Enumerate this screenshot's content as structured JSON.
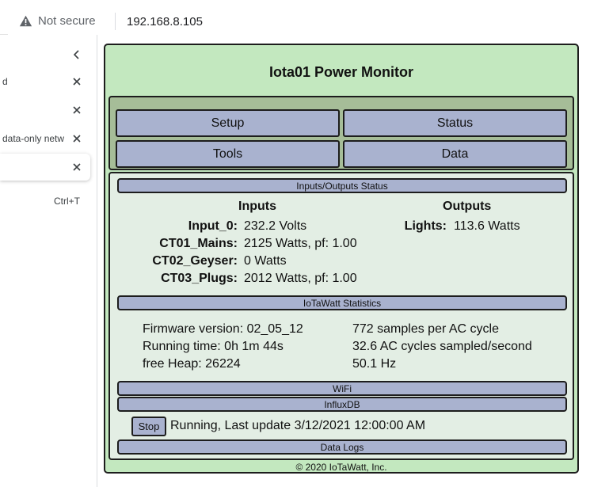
{
  "browser": {
    "security_label": "Not secure",
    "url": "192.168.8.105"
  },
  "sidebar": {
    "tabs": [
      {
        "label": "d"
      },
      {
        "label": ""
      },
      {
        "label": "data-only netw"
      },
      {
        "label": ""
      }
    ],
    "shortcut": "Ctrl+T"
  },
  "app": {
    "title": "Iota01 Power Monitor",
    "nav": {
      "setup": "Setup",
      "status": "Status",
      "tools": "Tools",
      "data": "Data"
    },
    "io_status": {
      "header": "Inputs/Outputs Status",
      "inputs_title": "Inputs",
      "outputs_title": "Outputs",
      "inputs": [
        {
          "name": "Input_0:",
          "value": "232.2 Volts"
        },
        {
          "name": "CT01_Mains:",
          "value": "2125 Watts, pf: 1.00"
        },
        {
          "name": "CT02_Geyser:",
          "value": "0 Watts"
        },
        {
          "name": "CT03_Plugs:",
          "value": "2012 Watts, pf: 1.00"
        }
      ],
      "outputs": [
        {
          "name": "Lights:",
          "value": "113.6 Watts"
        }
      ]
    },
    "statistics": {
      "header": "IoTaWatt Statistics",
      "firmware": "Firmware version: 02_05_12",
      "running_time": "Running time: 0h 1m 44s",
      "free_heap": "free Heap: 26224",
      "samples": "772 samples per AC cycle",
      "cycles": "32.6 AC cycles sampled/second",
      "frequency": "50.1 Hz"
    },
    "wifi_header": "WiFi",
    "influx": {
      "header": "InfluxDB",
      "stop_label": "Stop",
      "status": "Running, Last update 3/12/2021 12:00:00 AM"
    },
    "datalogs_header": "Data Logs",
    "footer": "© 2020 IoTaWatt, Inc."
  }
}
